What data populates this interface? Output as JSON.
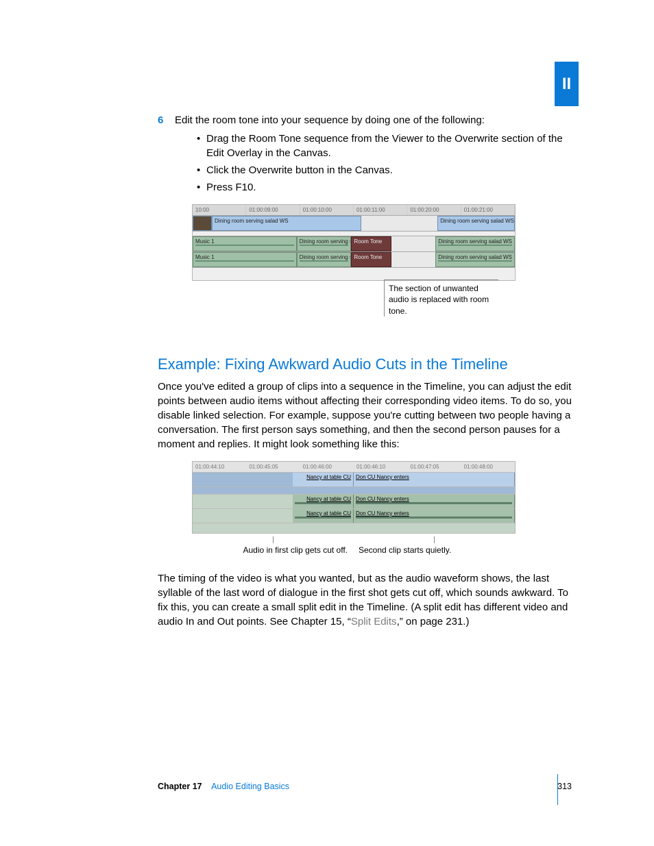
{
  "part_label": "II",
  "step": {
    "number": "6",
    "text": "Edit the room tone into your sequence by doing one of the following:",
    "bullets": [
      "Drag the Room Tone sequence from the Viewer to the Overwrite section of the Edit Overlay in the Canvas.",
      "Click the Overwrite button in the Canvas.",
      "Press F10."
    ]
  },
  "fig1": {
    "ruler": [
      "10:00",
      "01:00:09:00",
      "01:00:10:00",
      "01:00:11:00",
      "01:00:20:00",
      "01:00:21:00"
    ],
    "video_clip": "Dining room serving salad WS",
    "music_label": "Music 1",
    "a_clip": "Dining room serving salad WS",
    "tone_label": "Room Tone",
    "caption": "The section of unwanted audio is replaced with room tone."
  },
  "section_title": "Example:  Fixing Awkward Audio Cuts in the Timeline",
  "body_para_1": "Once you've edited a group of clips into a sequence in the Timeline, you can adjust the edit points between audio items without affecting their corresponding video items. To do so, you disable linked selection. For example, suppose you're cutting between two people having a conversation. The first person says something, and then the second person pauses for a moment and replies. It might look something like this:",
  "fig2": {
    "ruler": [
      "01:00:44:10",
      "01:00:45:05",
      "01:00:46:00",
      "01:00:46:10",
      "01:00:47:05",
      "01:00:48:00"
    ],
    "left_label": "Nancy at table CU",
    "right_label": "Don CU Nancy enters",
    "callout_left": "Audio in first clip gets cut off.",
    "callout_right": "Second clip starts quietly."
  },
  "body_para_2a": "The timing of the video is what you wanted, but as the audio waveform shows, the last syllable of the last word of dialogue in the first shot gets cut off, which sounds awkward. To fix this, you can create a small split edit in the Timeline. (A split edit has different video and audio In and Out points. See Chapter 15, “",
  "xref": "Split Edits",
  "body_para_2b": ",” on page 231.)",
  "footer": {
    "chapter_label": "Chapter 17",
    "chapter_title": "Audio Editing Basics",
    "page": "313"
  }
}
